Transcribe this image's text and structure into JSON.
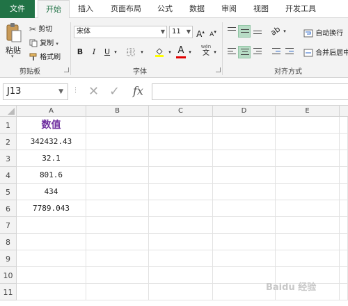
{
  "tabs": [
    "文件",
    "开始",
    "插入",
    "页面布局",
    "公式",
    "数据",
    "审阅",
    "视图",
    "开发工具"
  ],
  "active_tab": "开始",
  "accent_color": "#217346",
  "clipboard": {
    "paste": "粘贴",
    "cut": "剪切",
    "copy": "复制",
    "format_painter": "格式刷",
    "group": "剪贴板"
  },
  "font": {
    "name": "宋体",
    "size": "11",
    "grow": "A",
    "shrink": "A",
    "bold": "B",
    "italic": "I",
    "underline": "U",
    "font_color_label": "A",
    "phonetic": "wén",
    "phonetic2": "文",
    "group": "字体"
  },
  "alignment": {
    "wrap_text": "自动换行",
    "merge_center": "合并后居中",
    "group": "对齐方式"
  },
  "formula_bar": {
    "name_box": "J13",
    "cancel": "✕",
    "enter": "✓",
    "fx": "fx",
    "value": ""
  },
  "sheet": {
    "columns": [
      "A",
      "B",
      "C",
      "D",
      "E"
    ],
    "rows": [
      "1",
      "2",
      "3",
      "4",
      "5",
      "6",
      "7",
      "8",
      "9",
      "10",
      "11"
    ],
    "header_color": "#7030a0",
    "cells": [
      "数值",
      "342432.43",
      "32.1",
      "801.6",
      "434",
      "7789.043"
    ]
  },
  "watermark": "Baidu 经验"
}
